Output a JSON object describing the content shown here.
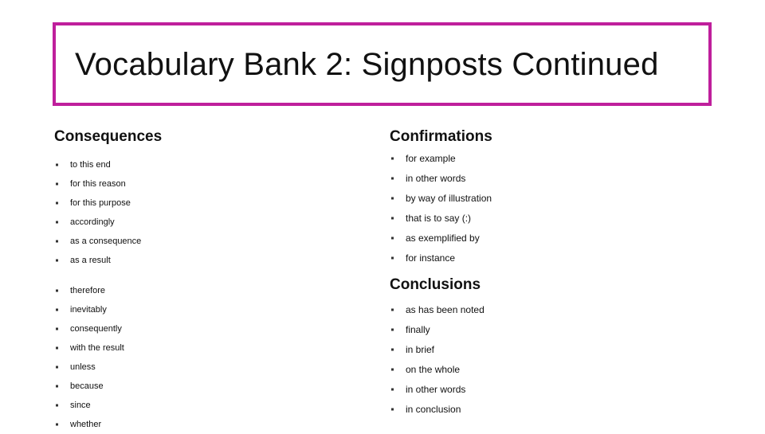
{
  "slide": {
    "title": "Vocabulary Bank 2: Signposts Continued",
    "accent_color": "#bf1f9c",
    "text_color": "#111111",
    "background_color": "#ffffff",
    "bullet_glyph": "square-bullet"
  },
  "columns": {
    "left": {
      "sections": [
        {
          "heading": "Consequences",
          "groups": [
            {
              "items": [
                "to this end",
                "for this reason",
                "for this purpose",
                "accordingly",
                "as a consequence",
                "as a result"
              ]
            },
            {
              "items": [
                "therefore",
                "inevitably",
                "consequently",
                "with the result",
                "unless",
                "because",
                "since",
                "whether"
              ]
            }
          ]
        }
      ]
    },
    "right": {
      "sections": [
        {
          "heading": "Confirmations",
          "groups": [
            {
              "items": [
                "for example",
                "in other words",
                "by way of illustration",
                "that is to say (:)",
                "as exemplified by",
                "for instance"
              ]
            }
          ]
        },
        {
          "heading": "Conclusions",
          "groups": [
            {
              "items": [
                "as has been noted",
                "finally",
                "in brief",
                "on the whole",
                "in other words",
                "in conclusion"
              ]
            }
          ]
        }
      ]
    }
  }
}
